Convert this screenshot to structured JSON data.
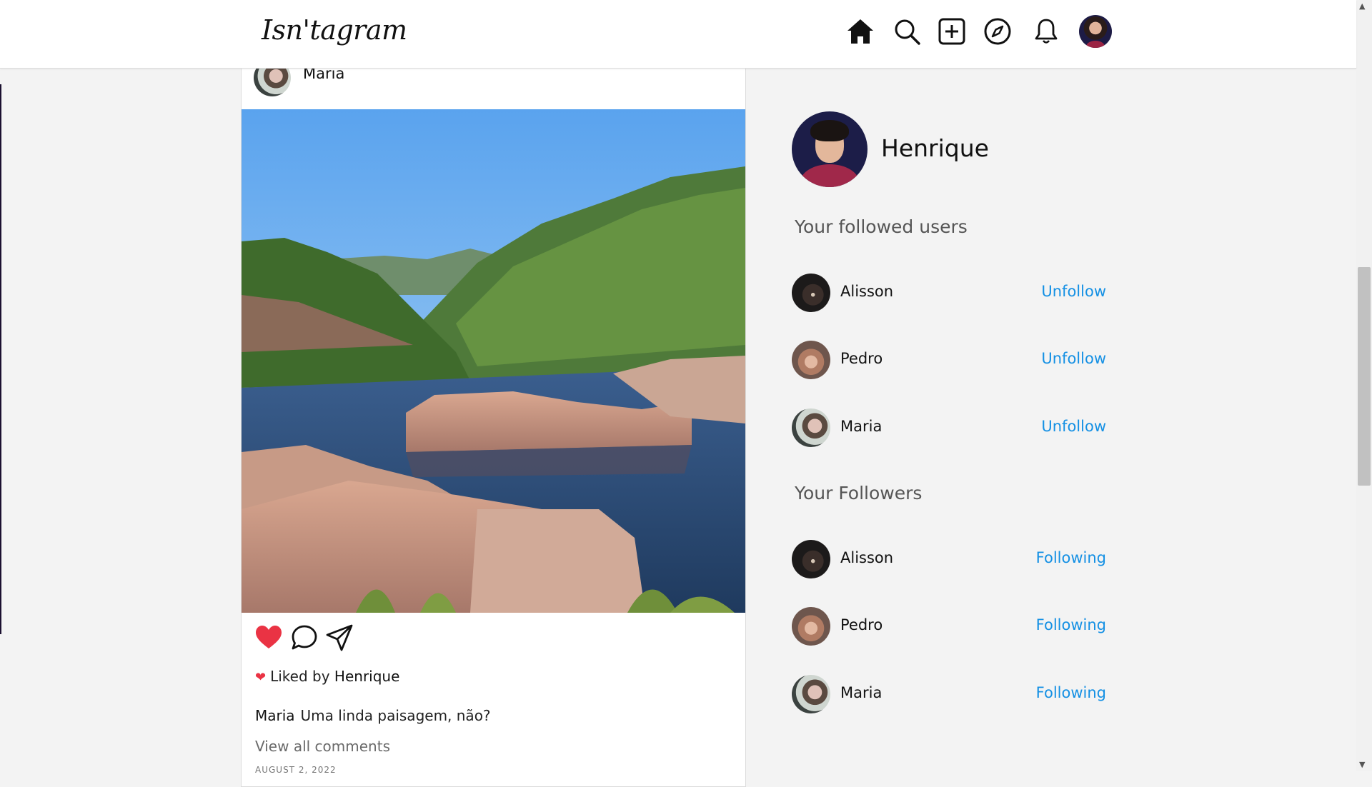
{
  "header": {
    "logo": "Isn'tagram",
    "icons": [
      "home-icon",
      "search-icon",
      "create-post-icon",
      "explore-icon",
      "notifications-icon",
      "profile-avatar"
    ]
  },
  "post": {
    "author": "Maria",
    "liked": true,
    "likes_prefix": "Liked by",
    "liked_by": "Henrique",
    "caption_user": "Maria",
    "caption_text": "Uma linda paisagem, não?",
    "view_all": "View all comments",
    "date": "AUGUST 2, 2022"
  },
  "sidebar": {
    "profile_name": "Henrique",
    "followed_title": "Your followed users",
    "followed": [
      {
        "name": "Alisson",
        "action": "Unfollow"
      },
      {
        "name": "Pedro",
        "action": "Unfollow"
      },
      {
        "name": "Maria",
        "action": "Unfollow"
      }
    ],
    "followers_title": "Your Followers",
    "followers": [
      {
        "name": "Alisson",
        "action": "Following"
      },
      {
        "name": "Pedro",
        "action": "Following"
      },
      {
        "name": "Maria",
        "action": "Following"
      }
    ]
  },
  "colors": {
    "accent": "#1490e4",
    "like": "#ea3344",
    "background": "#f3f3f3"
  }
}
